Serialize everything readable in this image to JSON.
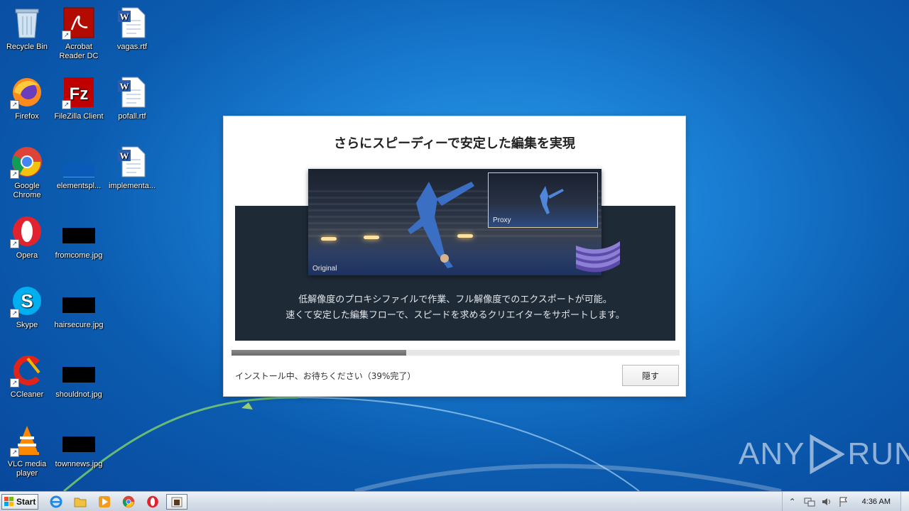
{
  "desktop": {
    "icons": [
      {
        "label": "Recycle Bin",
        "icon": "recycle-bin-icon"
      },
      {
        "label": "Acrobat Reader DC",
        "icon": "acrobat-icon"
      },
      {
        "label": "vagas.rtf",
        "icon": "word-doc-icon"
      },
      {
        "label": "Firefox",
        "icon": "firefox-icon"
      },
      {
        "label": "FileZilla Client",
        "icon": "filezilla-icon"
      },
      {
        "label": "pofall.rtf",
        "icon": "word-doc-icon"
      },
      {
        "label": "Google Chrome",
        "icon": "chrome-icon"
      },
      {
        "label": "elementspl...",
        "icon": "blank-file-icon"
      },
      {
        "label": "implementa...",
        "icon": "word-doc-icon"
      },
      {
        "label": "Opera",
        "icon": "opera-icon"
      },
      {
        "label": "fromcome.jpg",
        "icon": "image-thumb-icon"
      },
      {
        "label": "Skype",
        "icon": "skype-icon"
      },
      {
        "label": "hairsecure.jpg",
        "icon": "image-thumb-icon"
      },
      {
        "label": "CCleaner",
        "icon": "ccleaner-icon"
      },
      {
        "label": "shouldnot.jpg",
        "icon": "image-thumb-icon"
      },
      {
        "label": "VLC media player",
        "icon": "vlc-icon"
      },
      {
        "label": "townnews.jpg",
        "icon": "image-thumb-icon"
      }
    ]
  },
  "installer": {
    "title": "さらにスピーディーで安定した編集を実現",
    "image_labels": {
      "original": "Original",
      "proxy": "Proxy"
    },
    "description_line1": "低解像度のプロキシファイルで作業、フル解像度でのエクスポートが可能。",
    "description_line2": "速くて安定した編集フローで、スピードを求めるクリエイターをサポートします。",
    "status": "インストール中、お待ちください（39%完了）",
    "progress_percent": 39,
    "hide_button": "隠す"
  },
  "watermark": {
    "text_left": "ANY",
    "text_right": "RUN"
  },
  "taskbar": {
    "start_label": "Start",
    "apps": [
      "ie-icon",
      "explorer-icon",
      "media-player-icon",
      "chrome-icon",
      "opera-icon",
      "installer-icon"
    ],
    "clock": "4:36 AM"
  },
  "colors": {
    "desktop_blue": "#1a7fd4",
    "panel_dark": "#1f2a37",
    "progress_fill": "#6a6a6a"
  }
}
